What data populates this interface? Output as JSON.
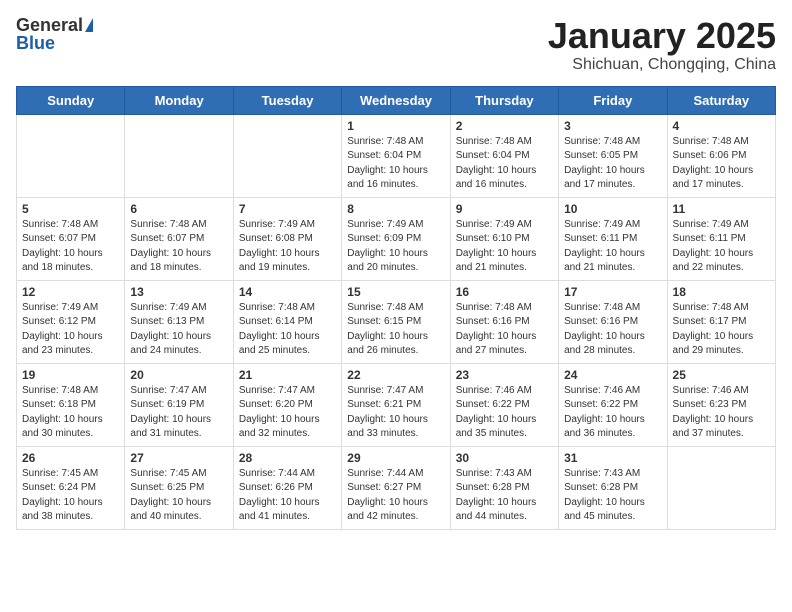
{
  "header": {
    "logo_general": "General",
    "logo_blue": "Blue",
    "title": "January 2025",
    "location": "Shichuan, Chongqing, China"
  },
  "days_of_week": [
    "Sunday",
    "Monday",
    "Tuesday",
    "Wednesday",
    "Thursday",
    "Friday",
    "Saturday"
  ],
  "weeks": [
    [
      {
        "day": "",
        "info": ""
      },
      {
        "day": "",
        "info": ""
      },
      {
        "day": "",
        "info": ""
      },
      {
        "day": "1",
        "info": "Sunrise: 7:48 AM\nSunset: 6:04 PM\nDaylight: 10 hours and 16 minutes."
      },
      {
        "day": "2",
        "info": "Sunrise: 7:48 AM\nSunset: 6:04 PM\nDaylight: 10 hours and 16 minutes."
      },
      {
        "day": "3",
        "info": "Sunrise: 7:48 AM\nSunset: 6:05 PM\nDaylight: 10 hours and 17 minutes."
      },
      {
        "day": "4",
        "info": "Sunrise: 7:48 AM\nSunset: 6:06 PM\nDaylight: 10 hours and 17 minutes."
      }
    ],
    [
      {
        "day": "5",
        "info": "Sunrise: 7:48 AM\nSunset: 6:07 PM\nDaylight: 10 hours and 18 minutes."
      },
      {
        "day": "6",
        "info": "Sunrise: 7:48 AM\nSunset: 6:07 PM\nDaylight: 10 hours and 18 minutes."
      },
      {
        "day": "7",
        "info": "Sunrise: 7:49 AM\nSunset: 6:08 PM\nDaylight: 10 hours and 19 minutes."
      },
      {
        "day": "8",
        "info": "Sunrise: 7:49 AM\nSunset: 6:09 PM\nDaylight: 10 hours and 20 minutes."
      },
      {
        "day": "9",
        "info": "Sunrise: 7:49 AM\nSunset: 6:10 PM\nDaylight: 10 hours and 21 minutes."
      },
      {
        "day": "10",
        "info": "Sunrise: 7:49 AM\nSunset: 6:11 PM\nDaylight: 10 hours and 21 minutes."
      },
      {
        "day": "11",
        "info": "Sunrise: 7:49 AM\nSunset: 6:11 PM\nDaylight: 10 hours and 22 minutes."
      }
    ],
    [
      {
        "day": "12",
        "info": "Sunrise: 7:49 AM\nSunset: 6:12 PM\nDaylight: 10 hours and 23 minutes."
      },
      {
        "day": "13",
        "info": "Sunrise: 7:49 AM\nSunset: 6:13 PM\nDaylight: 10 hours and 24 minutes."
      },
      {
        "day": "14",
        "info": "Sunrise: 7:48 AM\nSunset: 6:14 PM\nDaylight: 10 hours and 25 minutes."
      },
      {
        "day": "15",
        "info": "Sunrise: 7:48 AM\nSunset: 6:15 PM\nDaylight: 10 hours and 26 minutes."
      },
      {
        "day": "16",
        "info": "Sunrise: 7:48 AM\nSunset: 6:16 PM\nDaylight: 10 hours and 27 minutes."
      },
      {
        "day": "17",
        "info": "Sunrise: 7:48 AM\nSunset: 6:16 PM\nDaylight: 10 hours and 28 minutes."
      },
      {
        "day": "18",
        "info": "Sunrise: 7:48 AM\nSunset: 6:17 PM\nDaylight: 10 hours and 29 minutes."
      }
    ],
    [
      {
        "day": "19",
        "info": "Sunrise: 7:48 AM\nSunset: 6:18 PM\nDaylight: 10 hours and 30 minutes."
      },
      {
        "day": "20",
        "info": "Sunrise: 7:47 AM\nSunset: 6:19 PM\nDaylight: 10 hours and 31 minutes."
      },
      {
        "day": "21",
        "info": "Sunrise: 7:47 AM\nSunset: 6:20 PM\nDaylight: 10 hours and 32 minutes."
      },
      {
        "day": "22",
        "info": "Sunrise: 7:47 AM\nSunset: 6:21 PM\nDaylight: 10 hours and 33 minutes."
      },
      {
        "day": "23",
        "info": "Sunrise: 7:46 AM\nSunset: 6:22 PM\nDaylight: 10 hours and 35 minutes."
      },
      {
        "day": "24",
        "info": "Sunrise: 7:46 AM\nSunset: 6:22 PM\nDaylight: 10 hours and 36 minutes."
      },
      {
        "day": "25",
        "info": "Sunrise: 7:46 AM\nSunset: 6:23 PM\nDaylight: 10 hours and 37 minutes."
      }
    ],
    [
      {
        "day": "26",
        "info": "Sunrise: 7:45 AM\nSunset: 6:24 PM\nDaylight: 10 hours and 38 minutes."
      },
      {
        "day": "27",
        "info": "Sunrise: 7:45 AM\nSunset: 6:25 PM\nDaylight: 10 hours and 40 minutes."
      },
      {
        "day": "28",
        "info": "Sunrise: 7:44 AM\nSunset: 6:26 PM\nDaylight: 10 hours and 41 minutes."
      },
      {
        "day": "29",
        "info": "Sunrise: 7:44 AM\nSunset: 6:27 PM\nDaylight: 10 hours and 42 minutes."
      },
      {
        "day": "30",
        "info": "Sunrise: 7:43 AM\nSunset: 6:28 PM\nDaylight: 10 hours and 44 minutes."
      },
      {
        "day": "31",
        "info": "Sunrise: 7:43 AM\nSunset: 6:28 PM\nDaylight: 10 hours and 45 minutes."
      },
      {
        "day": "",
        "info": ""
      }
    ]
  ]
}
